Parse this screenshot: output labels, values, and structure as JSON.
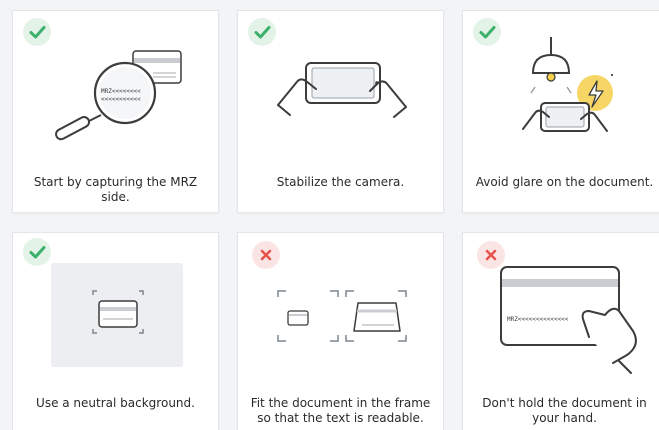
{
  "cards": [
    {
      "status": "ok",
      "status_icon": "check-icon",
      "caption": "Start by capturing the MRZ side.",
      "mrz_text": "MRZ<<<<<<<<",
      "mrz_text_2": "<<<<<<<<<<<"
    },
    {
      "status": "ok",
      "status_icon": "check-icon",
      "caption": "Stabilize the camera."
    },
    {
      "status": "ok",
      "status_icon": "check-icon",
      "caption": "Avoid glare on the document."
    },
    {
      "status": "ok",
      "status_icon": "check-icon",
      "caption": "Use a neutral background."
    },
    {
      "status": "bad",
      "status_icon": "cross-icon",
      "caption": "Fit the document in the frame so that the text is readable."
    },
    {
      "status": "bad",
      "status_icon": "cross-icon",
      "caption": "Don't hold the document in your hand.",
      "mrz_text": "MRZ<<<<<<<<<<<<<<"
    }
  ],
  "colors": {
    "ok": "#3bb06a",
    "bad": "#e5534b",
    "stroke": "#3c3c3c",
    "glare": "#f6cf4a"
  }
}
